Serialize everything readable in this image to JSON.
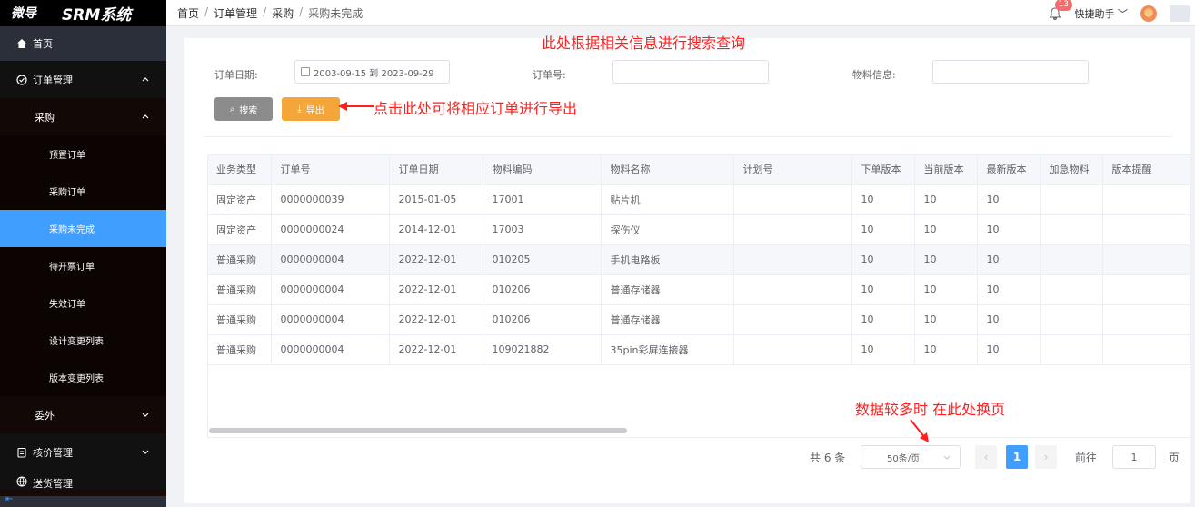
{
  "brand": {
    "logo": "微导",
    "system": "SRM系统"
  },
  "breadcrumb": [
    "首页",
    "订单管理",
    "采购",
    "采购未完成"
  ],
  "breadcrumb_sep": "/",
  "header": {
    "notification_count": "13",
    "helper_label": "快捷助手"
  },
  "sidebar": {
    "home": "首页",
    "order_mgmt": "订单管理",
    "purchase": "采购",
    "items": [
      "预置订单",
      "采购订单",
      "采购未完成",
      "待开票订单",
      "失效订单",
      "设计变更列表",
      "版本变更列表"
    ],
    "outsource": "委外",
    "pricing": "核价管理",
    "logistics": "送货管理"
  },
  "filters": {
    "order_date_label": "订单日期:",
    "order_date_value": "2003-09-15 到 2023-09-29",
    "order_no_label": "订单号:",
    "material_label": "物料信息:"
  },
  "buttons": {
    "search": "搜索",
    "export": "导出"
  },
  "table": {
    "columns": [
      "业务类型",
      "订单号",
      "订单日期",
      "物料编码",
      "物料名称",
      "计划号",
      "下单版本",
      "当前版本",
      "最新版本",
      "加急物料",
      "版本提醒"
    ],
    "rows": [
      [
        "固定资产",
        "0000000039",
        "2015-01-05",
        "17001",
        "贴片机",
        "",
        "10",
        "10",
        "10",
        "",
        ""
      ],
      [
        "固定资产",
        "0000000024",
        "2014-12-01",
        "17003",
        "探伤仪",
        "",
        "10",
        "10",
        "10",
        "",
        ""
      ],
      [
        "普通采购",
        "0000000004",
        "2022-12-01",
        "010205",
        "手机电路板",
        "",
        "10",
        "10",
        "10",
        "",
        ""
      ],
      [
        "普通采购",
        "0000000004",
        "2022-12-01",
        "010206",
        "普通存储器",
        "",
        "10",
        "10",
        "10",
        "",
        ""
      ],
      [
        "普通采购",
        "0000000004",
        "2022-12-01",
        "010206",
        "普通存储器",
        "",
        "10",
        "10",
        "10",
        "",
        ""
      ],
      [
        "普通采购",
        "0000000004",
        "2022-12-01",
        "109021882",
        "35pin彩屏连接器",
        "",
        "10",
        "10",
        "10",
        "",
        ""
      ]
    ]
  },
  "pagination": {
    "total": "共 6 条",
    "page_size": "50条/页",
    "current_page": "1",
    "goto_label": "前往",
    "goto_value": "1",
    "page_unit": "页"
  },
  "annotations": {
    "search_note": "此处根据相关信息进行搜索查询",
    "export_note": "点击此处可将相应订单进行导出",
    "paging_note": "数据较多时 在此处换页"
  },
  "colors": {
    "accent": "#409eff",
    "export_button": "#f4a63a",
    "annotation": "#ff1f1f",
    "sidebar_bg": "#1a0a06"
  }
}
